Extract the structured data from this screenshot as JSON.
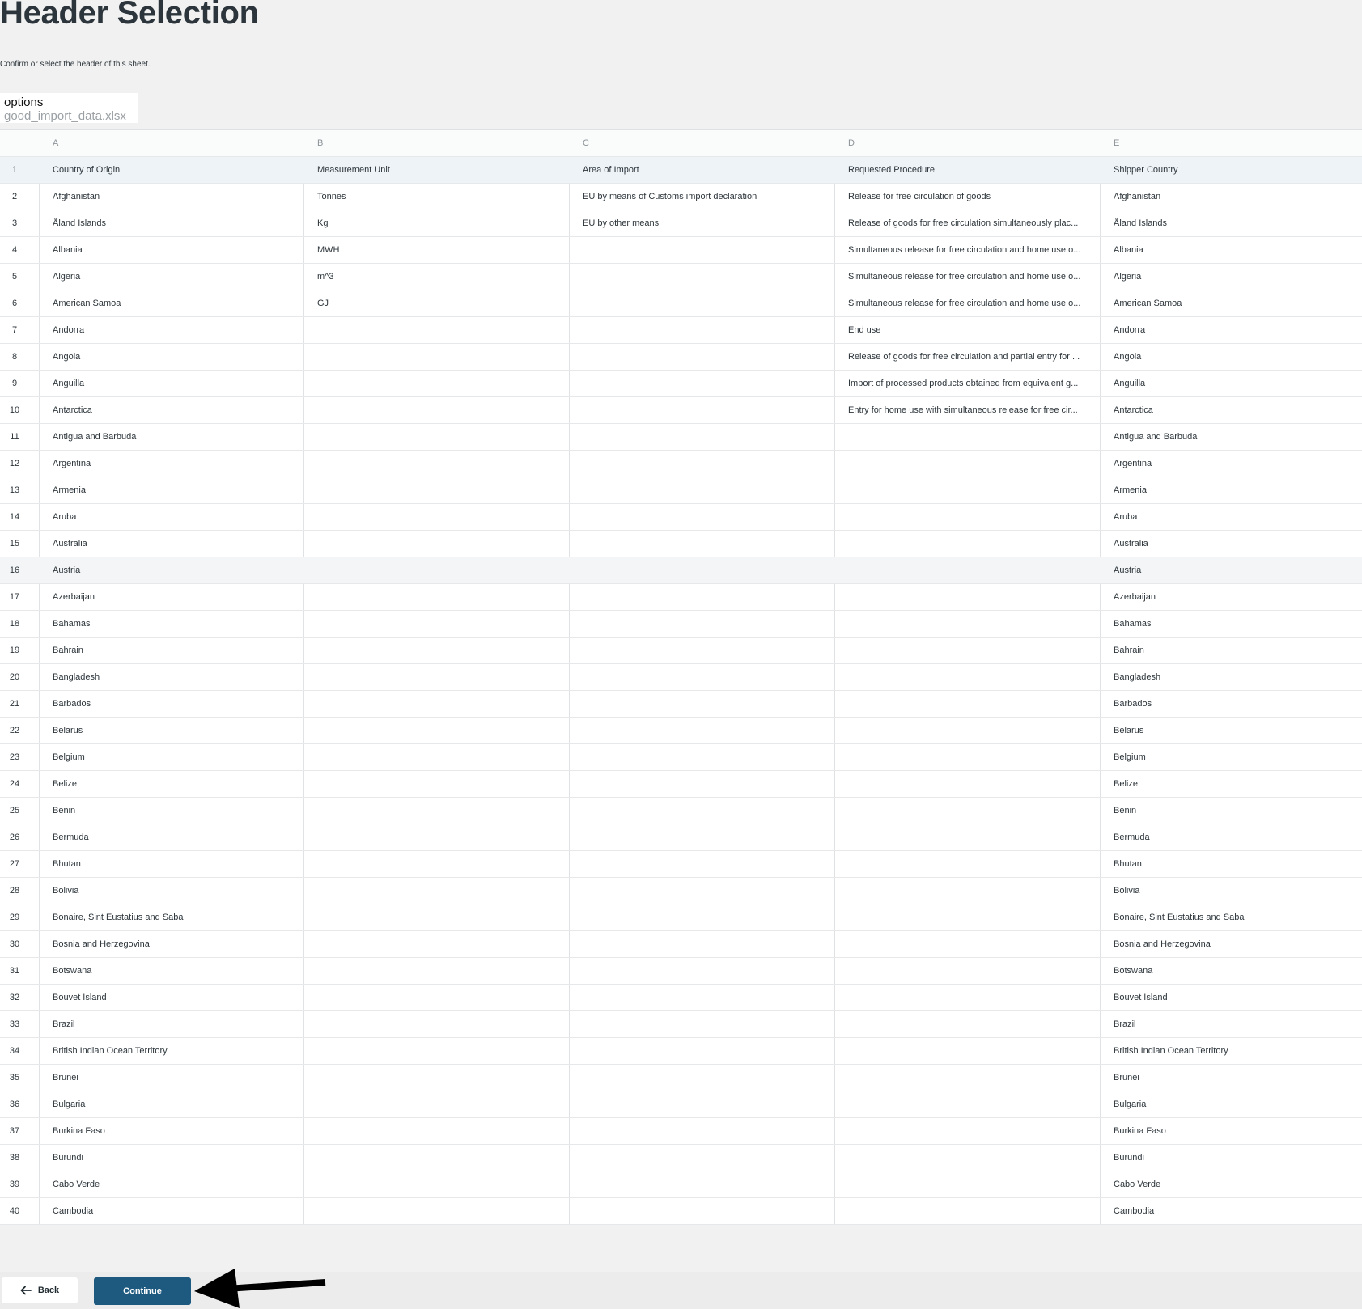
{
  "page": {
    "title": "Header Selection",
    "subtitle": "Confirm or select the header of this sheet."
  },
  "sheet": {
    "label": "options",
    "file_name": "good_import_data.xlsx"
  },
  "table": {
    "column_letters": [
      "A",
      "B",
      "C",
      "D",
      "E"
    ],
    "selected_header_row": 1,
    "rows": [
      {
        "n": "1",
        "cells": [
          "Country of Origin",
          "Measurement Unit",
          "Area of Import",
          "Requested Procedure",
          "Shipper Country"
        ]
      },
      {
        "n": "2",
        "cells": [
          "Afghanistan",
          "Tonnes",
          "EU by means of Customs import declaration",
          "Release for free circulation of goods",
          "Afghanistan"
        ]
      },
      {
        "n": "3",
        "cells": [
          "Åland Islands",
          "Kg",
          "EU by other means",
          "Release of goods for free circulation simultaneously plac...",
          "Åland Islands"
        ]
      },
      {
        "n": "4",
        "cells": [
          "Albania",
          "MWH",
          "",
          "Simultaneous release for free circulation and home use o...",
          "Albania"
        ]
      },
      {
        "n": "5",
        "cells": [
          "Algeria",
          "m^3",
          "",
          "Simultaneous release for free circulation and home use o...",
          "Algeria"
        ]
      },
      {
        "n": "6",
        "cells": [
          "American Samoa",
          "GJ",
          "",
          "Simultaneous release for free circulation and home use o...",
          "American Samoa"
        ]
      },
      {
        "n": "7",
        "cells": [
          "Andorra",
          "",
          "",
          "End use",
          "Andorra"
        ]
      },
      {
        "n": "8",
        "cells": [
          "Angola",
          "",
          "",
          "Release of goods for free circulation and partial entry for ...",
          "Angola"
        ]
      },
      {
        "n": "9",
        "cells": [
          "Anguilla",
          "",
          "",
          "Import of processed products obtained from equivalent g...",
          "Anguilla"
        ]
      },
      {
        "n": "10",
        "cells": [
          "Antarctica",
          "",
          "",
          "Entry for home use with simultaneous release for free cir...",
          "Antarctica"
        ]
      },
      {
        "n": "11",
        "cells": [
          "Antigua and Barbuda",
          "",
          "",
          "",
          "Antigua and Barbuda"
        ]
      },
      {
        "n": "12",
        "cells": [
          "Argentina",
          "",
          "",
          "",
          "Argentina"
        ]
      },
      {
        "n": "13",
        "cells": [
          "Armenia",
          "",
          "",
          "",
          "Armenia"
        ]
      },
      {
        "n": "14",
        "cells": [
          "Aruba",
          "",
          "",
          "",
          "Aruba"
        ]
      },
      {
        "n": "15",
        "cells": [
          "Australia",
          "",
          "",
          "",
          "Australia"
        ]
      },
      {
        "n": "16",
        "cells": [
          "Austria",
          "",
          "",
          "",
          "Austria"
        ]
      },
      {
        "n": "17",
        "cells": [
          "Azerbaijan",
          "",
          "",
          "",
          "Azerbaijan"
        ]
      },
      {
        "n": "18",
        "cells": [
          "Bahamas",
          "",
          "",
          "",
          "Bahamas"
        ]
      },
      {
        "n": "19",
        "cells": [
          "Bahrain",
          "",
          "",
          "",
          "Bahrain"
        ]
      },
      {
        "n": "20",
        "cells": [
          "Bangladesh",
          "",
          "",
          "",
          "Bangladesh"
        ]
      },
      {
        "n": "21",
        "cells": [
          "Barbados",
          "",
          "",
          "",
          "Barbados"
        ]
      },
      {
        "n": "22",
        "cells": [
          "Belarus",
          "",
          "",
          "",
          "Belarus"
        ]
      },
      {
        "n": "23",
        "cells": [
          "Belgium",
          "",
          "",
          "",
          "Belgium"
        ]
      },
      {
        "n": "24",
        "cells": [
          "Belize",
          "",
          "",
          "",
          "Belize"
        ]
      },
      {
        "n": "25",
        "cells": [
          "Benin",
          "",
          "",
          "",
          "Benin"
        ]
      },
      {
        "n": "26",
        "cells": [
          "Bermuda",
          "",
          "",
          "",
          "Bermuda"
        ]
      },
      {
        "n": "27",
        "cells": [
          "Bhutan",
          "",
          "",
          "",
          "Bhutan"
        ]
      },
      {
        "n": "28",
        "cells": [
          "Bolivia",
          "",
          "",
          "",
          "Bolivia"
        ]
      },
      {
        "n": "29",
        "cells": [
          "Bonaire, Sint Eustatius and Saba",
          "",
          "",
          "",
          "Bonaire, Sint Eustatius and Saba"
        ]
      },
      {
        "n": "30",
        "cells": [
          "Bosnia and Herzegovina",
          "",
          "",
          "",
          "Bosnia and Herzegovina"
        ]
      },
      {
        "n": "31",
        "cells": [
          "Botswana",
          "",
          "",
          "",
          "Botswana"
        ]
      },
      {
        "n": "32",
        "cells": [
          "Bouvet Island",
          "",
          "",
          "",
          "Bouvet Island"
        ]
      },
      {
        "n": "33",
        "cells": [
          "Brazil",
          "",
          "",
          "",
          "Brazil"
        ]
      },
      {
        "n": "34",
        "cells": [
          "British Indian Ocean Territory",
          "",
          "",
          "",
          "British Indian Ocean Territory"
        ]
      },
      {
        "n": "35",
        "cells": [
          "Brunei",
          "",
          "",
          "",
          "Brunei"
        ]
      },
      {
        "n": "36",
        "cells": [
          "Bulgaria",
          "",
          "",
          "",
          "Bulgaria"
        ]
      },
      {
        "n": "37",
        "cells": [
          "Burkina Faso",
          "",
          "",
          "",
          "Burkina Faso"
        ]
      },
      {
        "n": "38",
        "cells": [
          "Burundi",
          "",
          "",
          "",
          "Burundi"
        ]
      },
      {
        "n": "39",
        "cells": [
          "Cabo Verde",
          "",
          "",
          "",
          "Cabo Verde"
        ]
      },
      {
        "n": "40",
        "cells": [
          "Cambodia",
          "",
          "",
          "",
          "Cambodia"
        ]
      }
    ]
  },
  "footer": {
    "back_label": "Back",
    "continue_label": "Continue"
  },
  "icons": {
    "back": "arrow-left-icon",
    "pointer": "annotation-arrow-icon"
  },
  "colors": {
    "primary": "#1e5a80",
    "header_row_highlight": "#eef3f7",
    "title_text": "#2c353b"
  }
}
